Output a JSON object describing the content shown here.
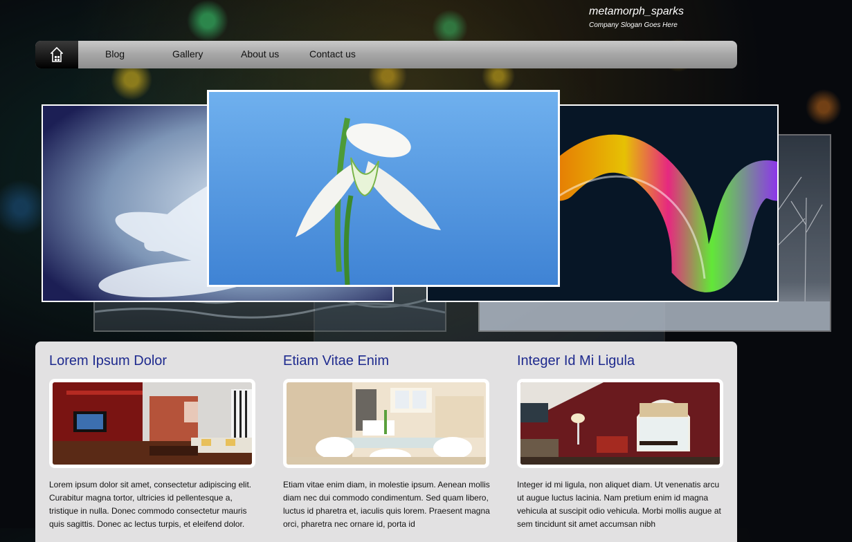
{
  "header": {
    "site_name": "metamorph_sparks",
    "slogan": "Company Slogan Goes Here"
  },
  "nav": {
    "home_icon": "home-icon",
    "items": [
      "Blog",
      "Gallery",
      "About us",
      "Contact us"
    ]
  },
  "slider": {
    "images": [
      "white-flower-closeup",
      "snowdrop-flower",
      "abstract-color-wave",
      "winter-trees",
      "water-surface"
    ]
  },
  "columns": [
    {
      "title": "Lorem Ipsum Dolor",
      "image": "living-room-with-tv",
      "text": "Lorem ipsum dolor sit amet, consectetur adipiscing elit. Curabitur magna tortor, ultricies id pellentesque a, tristique in nulla. Donec commodo consectetur mauris quis sagittis. Donec ac lectus turpis, et eleifend dolor."
    },
    {
      "title": "Etiam Vitae Enim",
      "image": "kitchen-dining-room",
      "text": "Etiam vitae enim diam, in molestie ipsum. Aenean mollis diam nec dui commodo condimentum. Sed quam libero, luctus id pharetra et, iaculis quis lorem. Praesent magna orci, pharetra nec ornare id, porta id"
    },
    {
      "title": "Integer Id Mi Ligula",
      "image": "red-living-room",
      "text": "Integer id mi ligula, non aliquet diam. Ut venenatis arcu ut augue luctus lacinia. Nam pretium enim id magna vehicula at suscipit odio vehicula. Morbi mollis augue at sem tincidunt sit amet accumsan nibh"
    }
  ]
}
